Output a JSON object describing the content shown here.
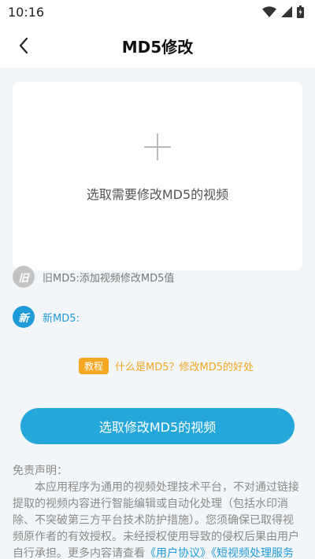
{
  "status_bar": {
    "time": "10:16"
  },
  "header": {
    "title": "MD5修改"
  },
  "upload": {
    "prompt": "选取需要修改MD5的视频"
  },
  "md5_old": {
    "badge": "旧",
    "label": "旧MD5:添加视频修改MD5值"
  },
  "md5_new": {
    "badge": "新",
    "label": "新MD5:"
  },
  "tutorial": {
    "tag": "教程",
    "link": "什么是MD5？修改MD5的好处"
  },
  "primary_button": {
    "label": "选取修改MD5的视频"
  },
  "disclaimer": {
    "title": "免责声明：",
    "body": "本应用程序为通用的视频处理技术平台，不对通过链接提取的视频内容进行智能编辑或自动化处理（包括水印消除、不突破第三方平台技术防护措施）。您须确保已取得视频原作者的有效授权。未经授权使用导致的侵权后果由用户自行承担。更多内容请查看",
    "link_user_agreement": "《用户协议》",
    "link_service_terms": "《短视频处理服务专项条款》"
  },
  "colors": {
    "accent": "#26a7dc",
    "new_badge": "#1f9bd8",
    "tutorial": "#f5a623",
    "background": "#f3f6f8"
  },
  "icons": {
    "back": "chevron-left-icon",
    "wifi": "wifi-icon",
    "signal": "signal-icon",
    "battery": "battery-icon",
    "plus": "plus-icon"
  }
}
